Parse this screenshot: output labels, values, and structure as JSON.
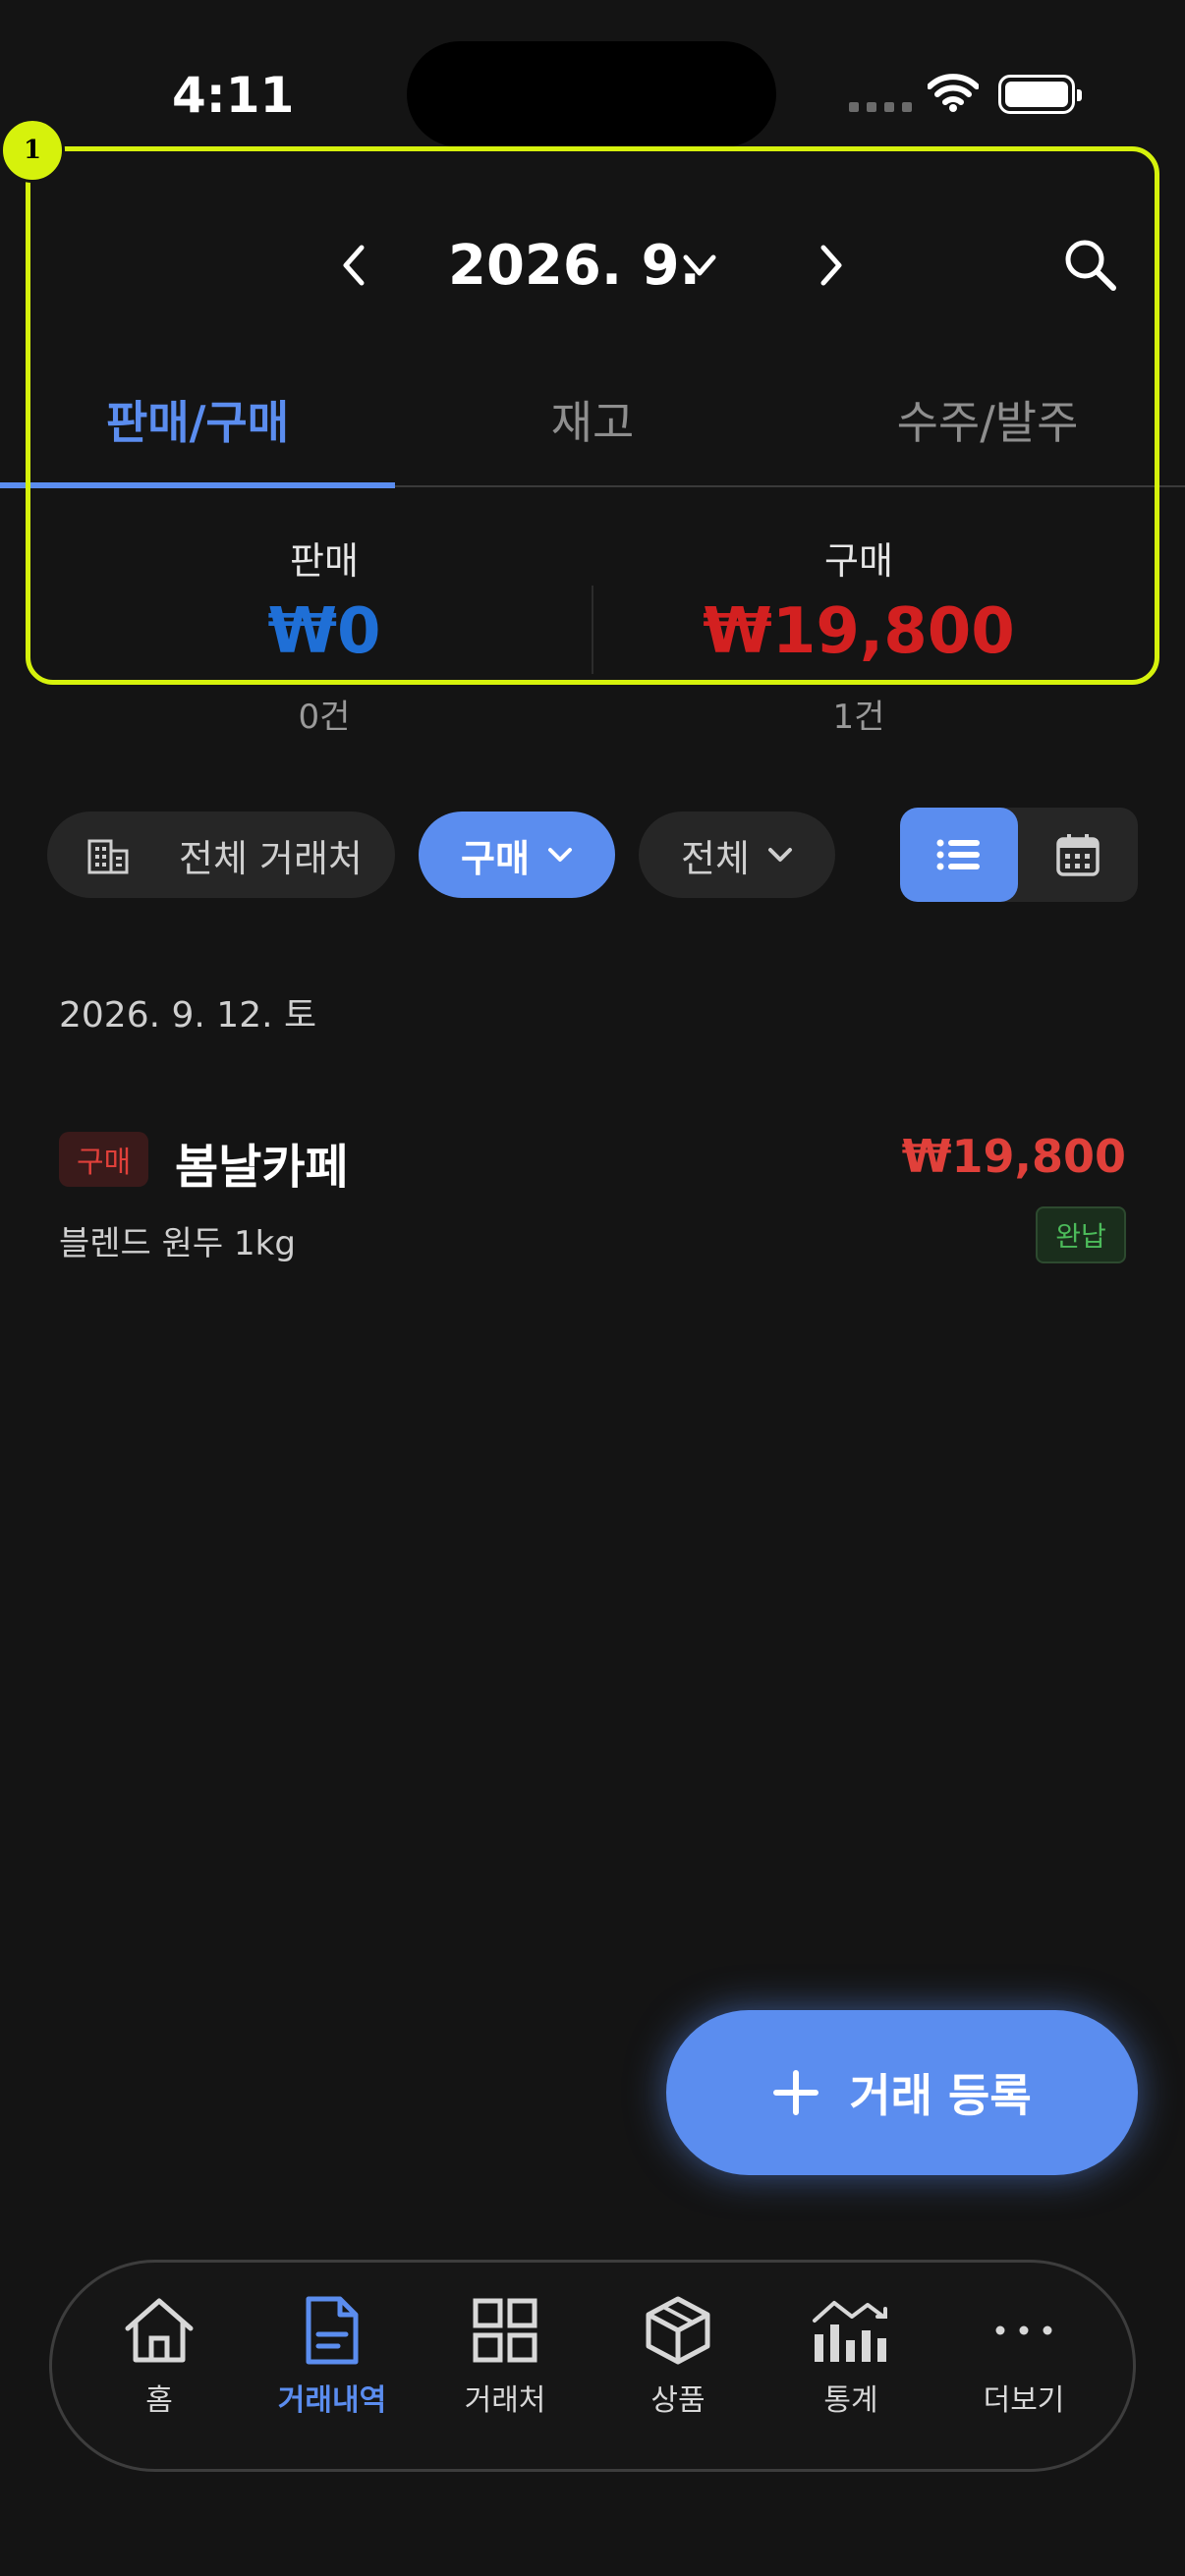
{
  "status_bar": {
    "time": "4:11"
  },
  "annotation": {
    "badge": "1"
  },
  "header": {
    "month": "2026. 9."
  },
  "tabs": [
    {
      "label": "판매/구매",
      "active": true
    },
    {
      "label": "재고",
      "active": false
    },
    {
      "label": "수주/발주",
      "active": false
    }
  ],
  "summary": {
    "sale": {
      "label": "판매",
      "amount": "₩0",
      "count": "0건",
      "color": "#1f6fd6"
    },
    "purchase": {
      "label": "구매",
      "amount": "₩19,800",
      "count": "1건",
      "color": "#d32020"
    }
  },
  "filters": {
    "partner": "전체 거래처",
    "type": "구매",
    "status": "전체"
  },
  "list": {
    "date": "2026. 9. 12. 토",
    "items": [
      {
        "type_badge": "구매",
        "partner": "봄날카페",
        "amount": "₩19,800",
        "item": "블렌드 원두 1kg",
        "status": "완납"
      }
    ]
  },
  "fab": {
    "label": "거래 등록"
  },
  "bottom_nav": [
    {
      "label": "홈",
      "icon": "home-icon"
    },
    {
      "label": "거래내역",
      "icon": "document-icon",
      "active": true
    },
    {
      "label": "거래처",
      "icon": "grid-icon"
    },
    {
      "label": "상품",
      "icon": "box-icon"
    },
    {
      "label": "통계",
      "icon": "chart-icon"
    },
    {
      "label": "더보기",
      "icon": "more-icon"
    }
  ],
  "colors": {
    "accent": "#5b8def",
    "purchase": "#d32020",
    "sale": "#1f6fd6",
    "highlight": "#d6f20c"
  }
}
